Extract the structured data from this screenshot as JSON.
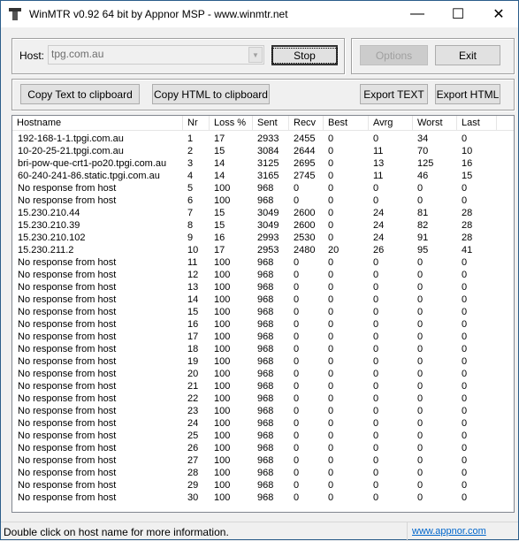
{
  "window": {
    "title": "WinMTR v0.92 64 bit by Appnor MSP - www.winmtr.net",
    "minimize": "—",
    "maximize": "☐",
    "close": "✕"
  },
  "host": {
    "label": "Host:",
    "value": "tpg.com.au"
  },
  "buttons": {
    "stop": "Stop",
    "options": "Options",
    "exit": "Exit",
    "copy_text": "Copy Text to clipboard",
    "copy_html": "Copy HTML to clipboard",
    "export_text": "Export TEXT",
    "export_html": "Export HTML"
  },
  "columns": [
    "Hostname",
    "Nr",
    "Loss %",
    "Sent",
    "Recv",
    "Best",
    "Avrg",
    "Worst",
    "Last"
  ],
  "rows": [
    [
      "192-168-1-1.tpgi.com.au",
      "1",
      "17",
      "2933",
      "2455",
      "0",
      "0",
      "34",
      "0"
    ],
    [
      "10-20-25-21.tpgi.com.au",
      "2",
      "15",
      "3084",
      "2644",
      "0",
      "11",
      "70",
      "10"
    ],
    [
      "bri-pow-que-crt1-po20.tpgi.com.au",
      "3",
      "14",
      "3125",
      "2695",
      "0",
      "13",
      "125",
      "16"
    ],
    [
      "60-240-241-86.static.tpgi.com.au",
      "4",
      "14",
      "3165",
      "2745",
      "0",
      "11",
      "46",
      "15"
    ],
    [
      "No response from host",
      "5",
      "100",
      "968",
      "0",
      "0",
      "0",
      "0",
      "0"
    ],
    [
      "No response from host",
      "6",
      "100",
      "968",
      "0",
      "0",
      "0",
      "0",
      "0"
    ],
    [
      "15.230.210.44",
      "7",
      "15",
      "3049",
      "2600",
      "0",
      "24",
      "81",
      "28"
    ],
    [
      "15.230.210.39",
      "8",
      "15",
      "3049",
      "2600",
      "0",
      "24",
      "82",
      "28"
    ],
    [
      "15.230.210.102",
      "9",
      "16",
      "2993",
      "2530",
      "0",
      "24",
      "91",
      "28"
    ],
    [
      "15.230.211.2",
      "10",
      "17",
      "2953",
      "2480",
      "20",
      "26",
      "95",
      "41"
    ],
    [
      "No response from host",
      "11",
      "100",
      "968",
      "0",
      "0",
      "0",
      "0",
      "0"
    ],
    [
      "No response from host",
      "12",
      "100",
      "968",
      "0",
      "0",
      "0",
      "0",
      "0"
    ],
    [
      "No response from host",
      "13",
      "100",
      "968",
      "0",
      "0",
      "0",
      "0",
      "0"
    ],
    [
      "No response from host",
      "14",
      "100",
      "968",
      "0",
      "0",
      "0",
      "0",
      "0"
    ],
    [
      "No response from host",
      "15",
      "100",
      "968",
      "0",
      "0",
      "0",
      "0",
      "0"
    ],
    [
      "No response from host",
      "16",
      "100",
      "968",
      "0",
      "0",
      "0",
      "0",
      "0"
    ],
    [
      "No response from host",
      "17",
      "100",
      "968",
      "0",
      "0",
      "0",
      "0",
      "0"
    ],
    [
      "No response from host",
      "18",
      "100",
      "968",
      "0",
      "0",
      "0",
      "0",
      "0"
    ],
    [
      "No response from host",
      "19",
      "100",
      "968",
      "0",
      "0",
      "0",
      "0",
      "0"
    ],
    [
      "No response from host",
      "20",
      "100",
      "968",
      "0",
      "0",
      "0",
      "0",
      "0"
    ],
    [
      "No response from host",
      "21",
      "100",
      "968",
      "0",
      "0",
      "0",
      "0",
      "0"
    ],
    [
      "No response from host",
      "22",
      "100",
      "968",
      "0",
      "0",
      "0",
      "0",
      "0"
    ],
    [
      "No response from host",
      "23",
      "100",
      "968",
      "0",
      "0",
      "0",
      "0",
      "0"
    ],
    [
      "No response from host",
      "24",
      "100",
      "968",
      "0",
      "0",
      "0",
      "0",
      "0"
    ],
    [
      "No response from host",
      "25",
      "100",
      "968",
      "0",
      "0",
      "0",
      "0",
      "0"
    ],
    [
      "No response from host",
      "26",
      "100",
      "968",
      "0",
      "0",
      "0",
      "0",
      "0"
    ],
    [
      "No response from host",
      "27",
      "100",
      "968",
      "0",
      "0",
      "0",
      "0",
      "0"
    ],
    [
      "No response from host",
      "28",
      "100",
      "968",
      "0",
      "0",
      "0",
      "0",
      "0"
    ],
    [
      "No response from host",
      "29",
      "100",
      "968",
      "0",
      "0",
      "0",
      "0",
      "0"
    ],
    [
      "No response from host",
      "30",
      "100",
      "968",
      "0",
      "0",
      "0",
      "0",
      "0"
    ]
  ],
  "status": {
    "message": "Double click on host name for more information.",
    "link": "www.appnor.com"
  }
}
